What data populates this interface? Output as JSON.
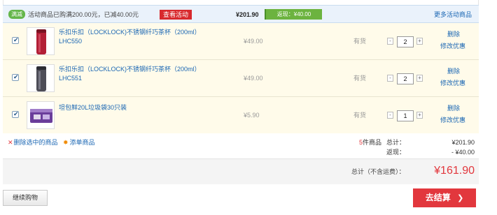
{
  "promo": {
    "tag": "满减",
    "text": "活动商品已购满200.00元，已减40.00元",
    "button": "查看活动",
    "total": "¥201.90",
    "saved_label": "返现：¥40.00",
    "more_link": "更多活动商品"
  },
  "items": [
    {
      "name": "乐扣乐扣（LOCKLOCK)不锈钢纤巧茶杯（200ml）LHC550",
      "price": "¥49.00",
      "stock": "有货",
      "qty_minus": "-",
      "quantity": "2",
      "qty_plus": "+",
      "delete": "删除",
      "change_promo": "修改优惠"
    },
    {
      "name": "乐扣乐扣（LOCKLOCK)不锈钢纤巧茶杯（200ml）LHC551",
      "price": "¥49.00",
      "stock": "有货",
      "qty_minus": "-",
      "quantity": "2",
      "qty_plus": "+",
      "delete": "删除",
      "change_promo": "修改优惠"
    },
    {
      "name": "坦包鲜20L垃圾袋30只装",
      "price": "¥5.90",
      "stock": "有货",
      "qty_minus": "-",
      "quantity": "1",
      "qty_plus": "+",
      "delete": "删除",
      "change_promo": "修改优惠"
    }
  ],
  "actions": {
    "delete_selected": "删除选中的商品",
    "add_to_list": "添单商品"
  },
  "summary": {
    "count": "5",
    "count_suffix": "件商品",
    "subtotal_label": "总计：",
    "subtotal": "¥201.90",
    "discount_label": "返现：",
    "discount": "- ¥40.00",
    "total_label": "总计（不含运费）：",
    "total": "¥161.90"
  },
  "footer": {
    "continue_label": "继续购物",
    "checkout_label": "去结算",
    "checkout_arrow": "❯"
  },
  "colors": {
    "accent": "#e2373d",
    "link": "#1a66b3",
    "row_bg": "#fffbea",
    "promo_green": "#6cb33f"
  }
}
